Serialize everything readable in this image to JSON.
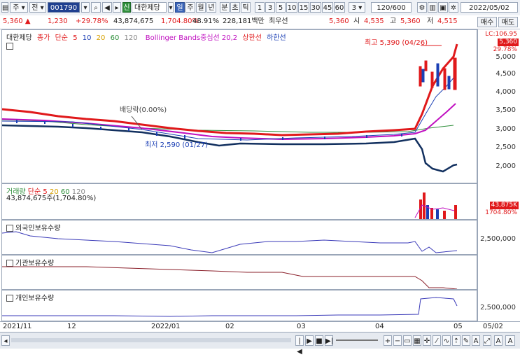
{
  "toolbar": {
    "market": "주",
    "type": "전",
    "code": "001790",
    "badge": "신",
    "name": "대한제당",
    "periods": [
      "일",
      "주",
      "월",
      "년",
      "분",
      "초",
      "틱"
    ],
    "active_period": "일",
    "intervals": [
      "1",
      "3",
      "5",
      "10",
      "15",
      "30",
      "45",
      "60"
    ],
    "count_select": "3",
    "count": "120/600",
    "date": "2022/05/02"
  },
  "quote": {
    "price": "5,360",
    "change": "1,230",
    "change_pct": "+29.78%",
    "volume": "43,874,675",
    "volume_pct": "1,704.80%",
    "ratio": "48.91%",
    "amount": "228,181백만",
    "best_label": "최우선",
    "last": "5,360",
    "open_label": "시",
    "open": "4,535",
    "high_label": "고",
    "high": "5,360",
    "low_label": "저",
    "low": "4,515",
    "buy_btn": "매수",
    "sell_btn": "매도"
  },
  "price_pane": {
    "stock_name": "대한제당",
    "legend": {
      "close": "종가",
      "sma": "단순",
      "ma5": "5",
      "ma10": "10",
      "ma20": "20",
      "ma60": "60",
      "ma120": "120",
      "bollinger": "Bollinger Bands중심선 20,2",
      "upper": "상한선",
      "lower": "하한선"
    },
    "annotations": {
      "dividend": "배당락(0.00%)",
      "high": "최고 5,390 (04/26)",
      "low": "최저 2,590 (01/27)"
    },
    "y_labels": [
      "5,000",
      "4,500",
      "4,000",
      "3,500",
      "3,000",
      "2,500",
      "2,000"
    ],
    "tags": {
      "lc": "LC:106.95",
      "price": "5,360",
      "pct": "29.78%"
    }
  },
  "volume_pane": {
    "title": "거래량",
    "sma": "단순",
    "ma5": "5",
    "ma20": "20",
    "ma60": "60",
    "ma120": "120",
    "value": "43,874,675주(1,704.80%)",
    "tags": {
      "v": "43,875K",
      "pct": "1704.80%"
    }
  },
  "foreign_pane": {
    "title": "외국인보유수량",
    "y_label": "2,500,000"
  },
  "inst_pane": {
    "title": "기관보유수량"
  },
  "indiv_pane": {
    "title": "개인보유수량",
    "y_label": "2,500,000"
  },
  "x_axis": [
    "2021/11",
    "12",
    "2022/01",
    "02",
    "03",
    "04",
    "05",
    "05/02"
  ],
  "colors": {
    "up": "#e0191b",
    "down": "#1b3fb4",
    "ma5": "#e0191b",
    "ma10": "#1b3fb4",
    "ma20": "#d6a000",
    "ma60": "#2f8f3b",
    "bollinger": "#c010c0"
  }
}
